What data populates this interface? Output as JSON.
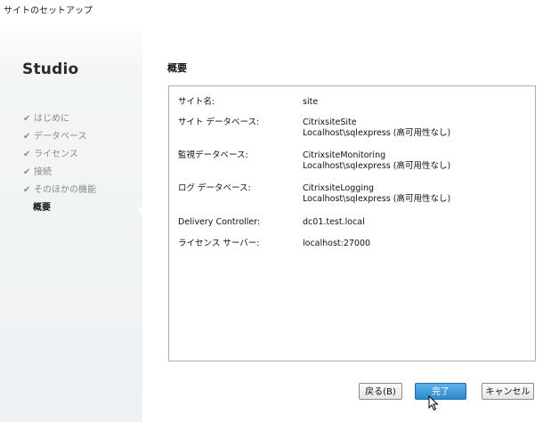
{
  "window": {
    "title": "サイトのセットアップ"
  },
  "sidebar": {
    "app_name": "Studio",
    "steps": [
      {
        "label": "はじめに",
        "done": true
      },
      {
        "label": "データベース",
        "done": true
      },
      {
        "label": "ライセンス",
        "done": true
      },
      {
        "label": "接続",
        "done": true
      },
      {
        "label": "そのほかの機能",
        "done": true
      },
      {
        "label": "概要",
        "done": false
      }
    ],
    "check_glyph": "✔"
  },
  "main": {
    "section_title": "概要",
    "summary": [
      {
        "label": "サイト名:",
        "values": [
          "site"
        ]
      },
      {
        "label": "サイト データベース:",
        "values": [
          "CitrixsiteSite",
          "Localhost\\sqlexpress (高可用性なし)"
        ]
      },
      {
        "label": "監視データベース:",
        "values": [
          "CitrixsiteMonitoring",
          "Localhost\\sqlexpress (高可用性なし)"
        ]
      },
      {
        "label": "ログ データベース:",
        "values": [
          "CitrixsiteLogging",
          "Localhost\\sqlexpress (高可用性なし)"
        ]
      },
      {
        "label": "Delivery Controller:",
        "values": [
          "dc01.test.local"
        ]
      },
      {
        "label": "ライセンス サーバー:",
        "values": [
          "localhost:27000"
        ]
      }
    ]
  },
  "footer": {
    "back_label": "戻る(B)",
    "finish_label": "完了",
    "cancel_label": "キャンセル"
  },
  "colors": {
    "accent": "#2e89cc",
    "step_done": "#8a8a8a",
    "border": "#a9b1b8"
  }
}
